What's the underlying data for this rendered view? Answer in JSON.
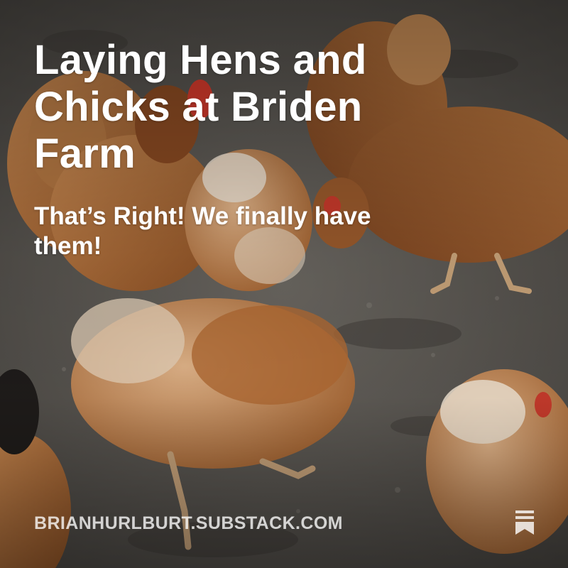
{
  "post": {
    "title": "Laying Hens and Chicks at Briden Farm",
    "subtitle": "That’s Right! We finally have them!"
  },
  "publication": {
    "domain": "BRIANHURLBURT.SUBSTACK.COM",
    "icon": "substack-bookmark-icon"
  },
  "photo": {
    "subject": "chickens-photo"
  },
  "colors": {
    "text": "#ffffff",
    "domain_text": "rgba(255,255,255,0.78)",
    "ground": "#5b5752",
    "hen_plumage": "#a8642c"
  }
}
